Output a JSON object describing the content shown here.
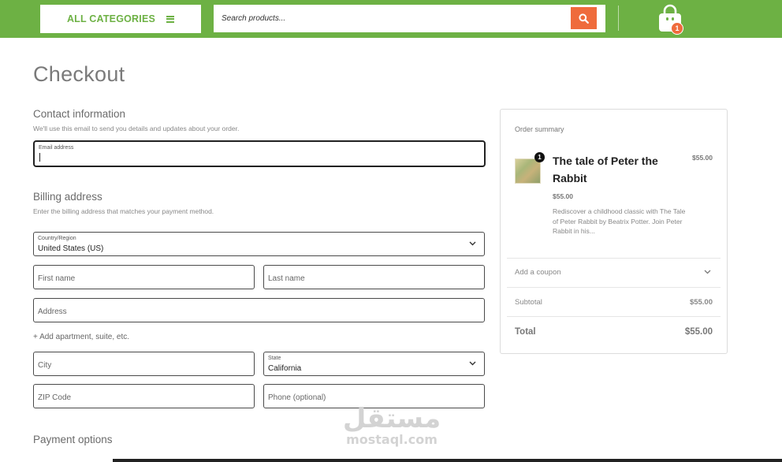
{
  "header": {
    "categories_label": "ALL CATEGORIES",
    "search_placeholder": "Search products...",
    "cart_count": "1",
    "brand_green": "#6db144",
    "accent_orange": "#ef6b3c",
    "icons": [
      "hamburger-icon",
      "search-icon",
      "shopping-bag-icon"
    ]
  },
  "page": {
    "title": "Checkout"
  },
  "contact": {
    "heading": "Contact information",
    "subtext": "We'll use this email to send you details and updates about your order.",
    "email_label": "Email address",
    "email_value": ""
  },
  "billing": {
    "heading": "Billing address",
    "subtext": "Enter the billing address that matches your payment method.",
    "country_label": "Country/Region",
    "country_value": "United States (US)",
    "first_name_placeholder": "First name",
    "last_name_placeholder": "Last name",
    "address_placeholder": "Address",
    "add_apartment": "+ Add apartment, suite, etc.",
    "city_placeholder": "City",
    "state_label": "State",
    "state_value": "California",
    "zip_placeholder": "ZIP Code",
    "phone_placeholder": "Phone (optional)"
  },
  "payment": {
    "heading": "Payment options"
  },
  "summary": {
    "title": "Order summary",
    "item": {
      "qty": "1",
      "name": "The tale of Peter the Rabbit",
      "line_total": "$55.00",
      "price": "$55.00",
      "description": "Rediscover a childhood classic with The Tale of Peter Rabbit by Beatrix Potter. Join Peter Rabbit in his..."
    },
    "coupon_label": "Add a coupon",
    "subtotal_label": "Subtotal",
    "subtotal_value": "$55.00",
    "total_label": "Total",
    "total_value": "$55.00"
  },
  "watermark": {
    "arabic": "مستقل",
    "latin": "mostaql.com"
  }
}
